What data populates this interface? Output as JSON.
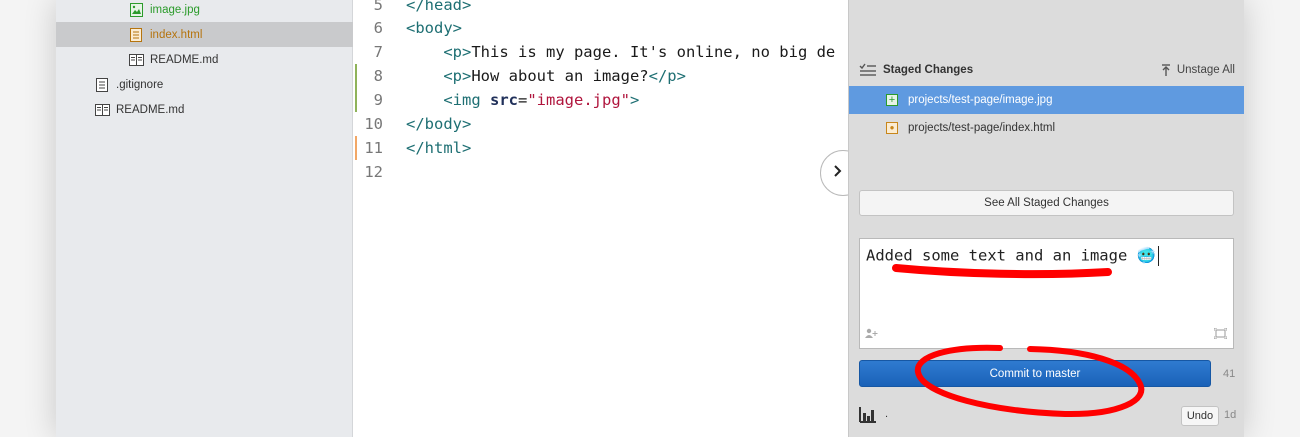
{
  "sidebar": {
    "files": [
      {
        "name": "image.jpg",
        "icon": "image-file-icon",
        "status": "added"
      },
      {
        "name": "index.html",
        "icon": "html-file-icon",
        "status": "modified"
      },
      {
        "name": "README.md",
        "icon": "readme-file-icon",
        "status": "none"
      },
      {
        "name": ".gitignore",
        "icon": "text-file-icon",
        "status": "none"
      },
      {
        "name": "README.md",
        "icon": "readme-file-icon",
        "status": "none"
      }
    ]
  },
  "editor": {
    "lines": [
      {
        "num": "5",
        "code": "</head>"
      },
      {
        "num": "6",
        "code": "<body>"
      },
      {
        "num": "7",
        "code": "    <p>This is my page. It's online, no big de"
      },
      {
        "num": "8",
        "code": "    <p>How about an image?</p>"
      },
      {
        "num": "9",
        "code": "    <img src=\"image.jpg\">"
      },
      {
        "num": "10",
        "code": "</body>"
      },
      {
        "num": "11",
        "code": "</html>"
      },
      {
        "num": "12",
        "code": ""
      }
    ],
    "colors": {
      "tag": "#1e6f73",
      "attr": "#20305a",
      "string": "#b0153d",
      "added_marker": "#8fb35a",
      "modified_marker": "#f2a766"
    }
  },
  "git_panel": {
    "staged_title": "Staged Changes",
    "unstage_all_label": "Unstage All",
    "staged_files": [
      {
        "path": "projects/test-page/image.jpg",
        "status": "added",
        "selected": true
      },
      {
        "path": "projects/test-page/index.html",
        "status": "modified",
        "selected": false
      }
    ],
    "see_all_label": "See All Staged Changes",
    "commit_message": "Added some text and an image 🥶",
    "commit_button_label": "Commit to master",
    "char_count": "41",
    "history": {
      "text": ".",
      "undo_label": "Undo",
      "age": "1d"
    },
    "accent_color": "#1a62b8",
    "annotation_color": "#ff0000"
  }
}
